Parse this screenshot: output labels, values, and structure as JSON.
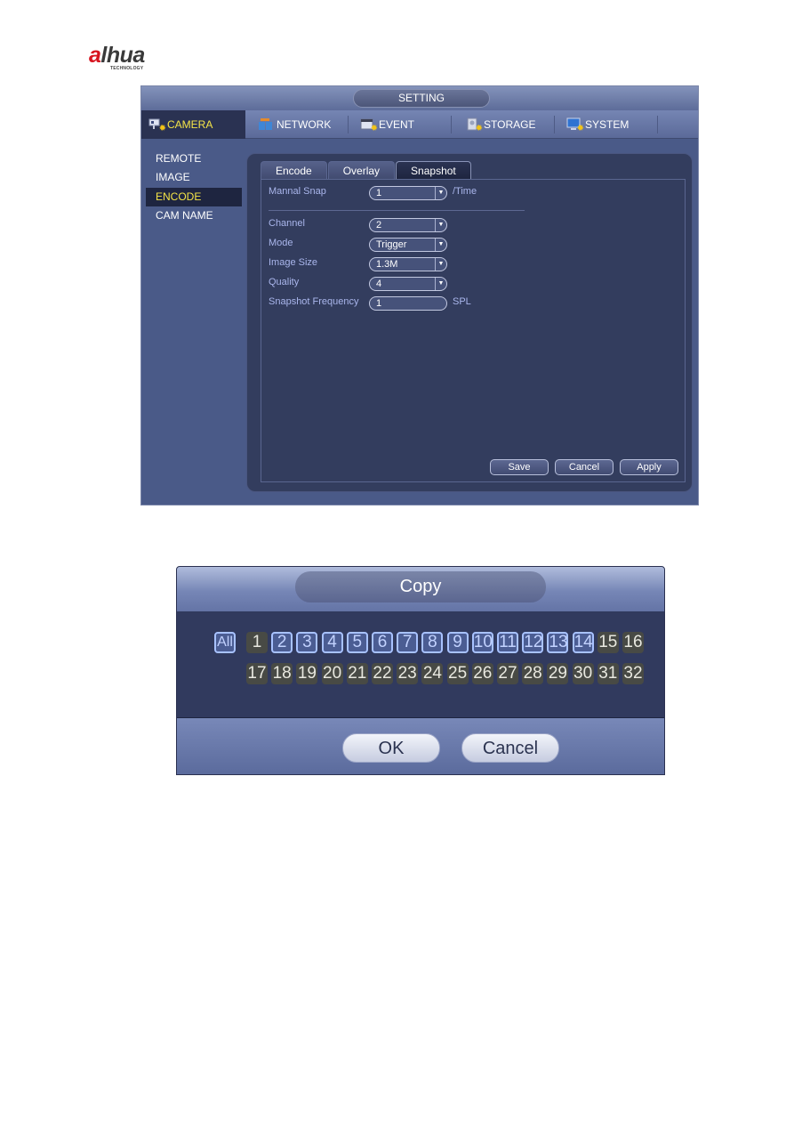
{
  "logo": {
    "brand_a": "a",
    "brand_rest": "lhua",
    "sub": "TECHNOLOGY"
  },
  "setting_window": {
    "title": "SETTING",
    "menu": [
      {
        "label": "CAMERA",
        "icon": "camera-icon",
        "active": true
      },
      {
        "label": "NETWORK",
        "icon": "network-icon",
        "active": false
      },
      {
        "label": "EVENT",
        "icon": "event-icon",
        "active": false
      },
      {
        "label": "STORAGE",
        "icon": "storage-icon",
        "active": false
      },
      {
        "label": "SYSTEM",
        "icon": "system-icon",
        "active": false
      }
    ],
    "sidebar": [
      {
        "label": "REMOTE",
        "active": false
      },
      {
        "label": "IMAGE",
        "active": false
      },
      {
        "label": "ENCODE",
        "active": true
      },
      {
        "label": "CAM NAME",
        "active": false
      }
    ],
    "tabs": [
      {
        "label": "Encode",
        "active": false
      },
      {
        "label": "Overlay",
        "active": false
      },
      {
        "label": "Snapshot",
        "active": true
      }
    ],
    "form": {
      "manual_snap": {
        "label": "Mannal Snap",
        "value": "1",
        "unit": "/Time"
      },
      "channel": {
        "label": "Channel",
        "value": "2"
      },
      "mode": {
        "label": "Mode",
        "value": "Trigger"
      },
      "image_size": {
        "label": "Image Size",
        "value": "1.3M"
      },
      "quality": {
        "label": "Quality",
        "value": "4"
      },
      "snapshot_frequency": {
        "label": "Snapshot Frequency",
        "value": "1",
        "unit": "SPL"
      }
    },
    "buttons": {
      "save": "Save",
      "cancel": "Cancel",
      "apply": "Apply"
    },
    "colors": {
      "active_text": "#f5e547",
      "label_text": "#aab6ec"
    }
  },
  "copy_dialog": {
    "title": "Copy",
    "all_label": "All",
    "channels": [
      {
        "n": "1",
        "checked": false
      },
      {
        "n": "2",
        "checked": true
      },
      {
        "n": "3",
        "checked": true
      },
      {
        "n": "4",
        "checked": true
      },
      {
        "n": "5",
        "checked": true
      },
      {
        "n": "6",
        "checked": true
      },
      {
        "n": "7",
        "checked": true
      },
      {
        "n": "8",
        "checked": true
      },
      {
        "n": "9",
        "checked": true
      },
      {
        "n": "10",
        "checked": true
      },
      {
        "n": "11",
        "checked": true
      },
      {
        "n": "12",
        "checked": true
      },
      {
        "n": "13",
        "checked": true
      },
      {
        "n": "14",
        "checked": true
      },
      {
        "n": "15",
        "checked": false
      },
      {
        "n": "16",
        "checked": false
      },
      {
        "n": "17",
        "checked": false
      },
      {
        "n": "18",
        "checked": false
      },
      {
        "n": "19",
        "checked": false
      },
      {
        "n": "20",
        "checked": false
      },
      {
        "n": "21",
        "checked": false
      },
      {
        "n": "22",
        "checked": false
      },
      {
        "n": "23",
        "checked": false
      },
      {
        "n": "24",
        "checked": false
      },
      {
        "n": "25",
        "checked": false
      },
      {
        "n": "26",
        "checked": false
      },
      {
        "n": "27",
        "checked": false
      },
      {
        "n": "28",
        "checked": false
      },
      {
        "n": "29",
        "checked": false
      },
      {
        "n": "30",
        "checked": false
      },
      {
        "n": "31",
        "checked": false
      },
      {
        "n": "32",
        "checked": false
      }
    ],
    "ok_label": "OK",
    "cancel_label": "Cancel"
  }
}
